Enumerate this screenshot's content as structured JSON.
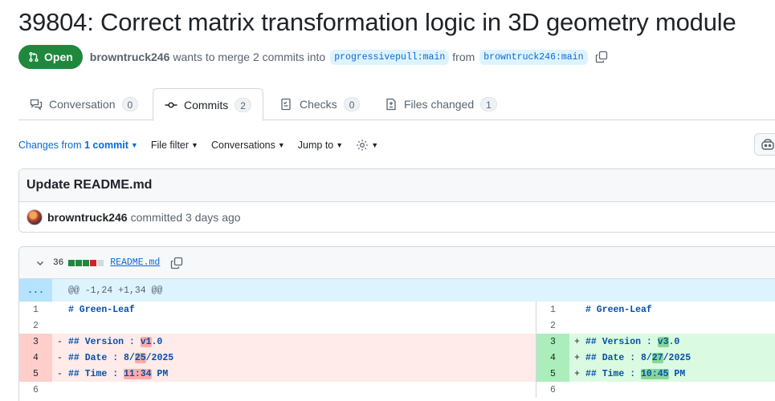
{
  "pr": {
    "title": "39804: Correct matrix transformation logic in 3D geometry module",
    "state": "Open",
    "author": "browntruck246",
    "merge_text": "wants to merge 2 commits into",
    "base_branch": "progressivepull:main",
    "from_text": "from",
    "head_branch": "browntruck246:main"
  },
  "tabs": [
    {
      "label": "Conversation",
      "count": "0"
    },
    {
      "label": "Commits",
      "count": "2"
    },
    {
      "label": "Checks",
      "count": "0"
    },
    {
      "label": "Files changed",
      "count": "1"
    }
  ],
  "toolbar": {
    "changes_prefix": "Changes from",
    "changes_value": "1 commit",
    "file_filter": "File filter",
    "conversations": "Conversations",
    "jump_to": "Jump to"
  },
  "commit": {
    "message": "Update README.md",
    "author": "browntruck246",
    "time_text": "committed 3 days ago"
  },
  "file": {
    "changes": "36",
    "name": "README.md",
    "hunk": "@@ -1,24 +1,34 @@",
    "expander": "...",
    "diffstat": [
      "add",
      "add",
      "add",
      "del",
      "neutral"
    ]
  },
  "diff": {
    "left": [
      {
        "num": "1",
        "type": "ctx",
        "sign": " ",
        "parts": [
          {
            "t": "# Green-Leaf",
            "h": false
          }
        ]
      },
      {
        "num": "2",
        "type": "ctx",
        "sign": " ",
        "parts": []
      },
      {
        "num": "3",
        "type": "del",
        "sign": "-",
        "parts": [
          {
            "t": "## Version : ",
            "h": false
          },
          {
            "t": "v1",
            "h": true
          },
          {
            "t": ".0",
            "h": false
          }
        ]
      },
      {
        "num": "4",
        "type": "del",
        "sign": "-",
        "parts": [
          {
            "t": "## Date : 8/",
            "h": false
          },
          {
            "t": "25",
            "h": true
          },
          {
            "t": "/2025",
            "h": false
          }
        ]
      },
      {
        "num": "5",
        "type": "del",
        "sign": "-",
        "parts": [
          {
            "t": "## Time : ",
            "h": false
          },
          {
            "t": "11:34",
            "h": true
          },
          {
            "t": " PM",
            "h": false
          }
        ]
      },
      {
        "num": "6",
        "type": "ctx",
        "sign": " ",
        "parts": []
      }
    ],
    "right": [
      {
        "num": "1",
        "type": "ctx",
        "sign": " ",
        "parts": [
          {
            "t": "# Green-Leaf",
            "h": false
          }
        ]
      },
      {
        "num": "2",
        "type": "ctx",
        "sign": " ",
        "parts": []
      },
      {
        "num": "3",
        "type": "add",
        "sign": "+",
        "parts": [
          {
            "t": "## Version : ",
            "h": false
          },
          {
            "t": "v3",
            "h": true
          },
          {
            "t": ".0",
            "h": false
          }
        ]
      },
      {
        "num": "4",
        "type": "add",
        "sign": "+",
        "parts": [
          {
            "t": "## Date : 8/",
            "h": false
          },
          {
            "t": "27",
            "h": true
          },
          {
            "t": "/2025",
            "h": false
          }
        ]
      },
      {
        "num": "5",
        "type": "add",
        "sign": "+",
        "parts": [
          {
            "t": "## Time : ",
            "h": false
          },
          {
            "t": "10:45",
            "h": true
          },
          {
            "t": " PM",
            "h": false
          }
        ]
      },
      {
        "num": "6",
        "type": "ctx",
        "sign": " ",
        "parts": []
      }
    ]
  },
  "icons": {
    "state": "git-pull-request-icon",
    "copy": "copy-icon",
    "conversation": "comment-discussion-icon",
    "commits": "git-commit-icon",
    "checks": "checklist-icon",
    "files": "file-diff-icon",
    "settings": "gear-icon",
    "copilot": "copilot-icon",
    "collapse": "chevron-down-icon"
  },
  "colors": {
    "open_green": "#1f883d",
    "link_blue": "#0969da",
    "deletion_bg": "#ffebe9",
    "addition_bg": "#dafbe1"
  }
}
